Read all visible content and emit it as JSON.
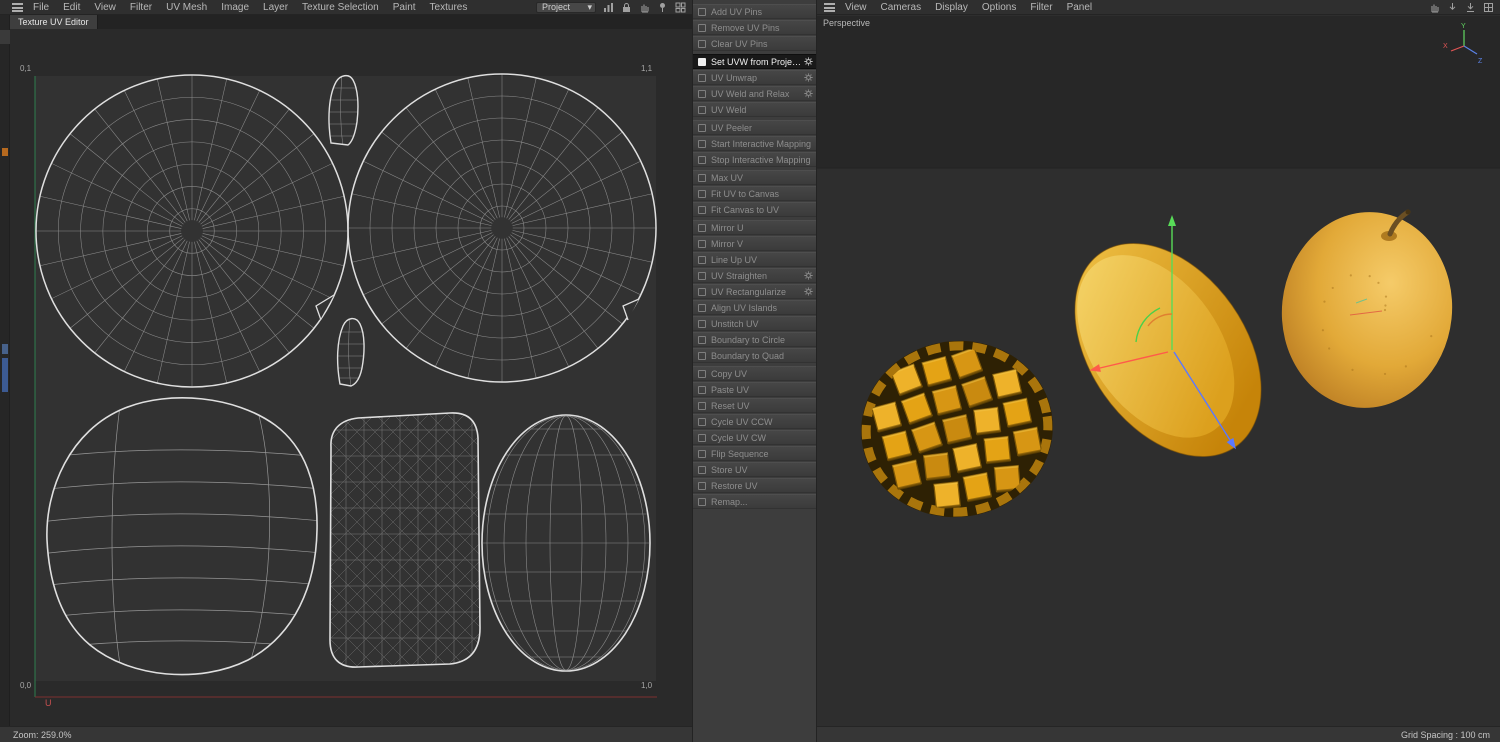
{
  "left_editor": {
    "menu": [
      "File",
      "Edit",
      "View",
      "Filter",
      "UV Mesh",
      "Image",
      "Layer",
      "Texture Selection",
      "Paint",
      "Textures"
    ],
    "project_dropdown": "Project",
    "tab": "Texture UV Editor",
    "corners": {
      "tl": "0,1",
      "tr": "1,1",
      "bl": "0,0",
      "br": "1,0"
    },
    "u_axis_label": "U",
    "status_zoom": "Zoom: 259.0%"
  },
  "icons": {
    "dropdown_caret": "▾"
  },
  "uv_commands": {
    "groups": [
      {
        "items": [
          {
            "label": "Add UV Pins",
            "icon": "add-uv-pins"
          },
          {
            "label": "Remove UV Pins",
            "icon": "remove-uv-pins"
          },
          {
            "label": "Clear UV Pins",
            "icon": "clear-uv-pins"
          }
        ]
      },
      {
        "items": [
          {
            "label": "Set UVW from Projection",
            "icon": "set-uvw-from-projection",
            "enabled": true,
            "gear": true
          },
          {
            "label": "UV Unwrap",
            "icon": "uv-unwrap",
            "gear": true
          },
          {
            "label": "UV Weld and Relax",
            "icon": "uv-weld-and-relax",
            "gear": true
          },
          {
            "label": "UV Weld",
            "icon": "uv-weld"
          }
        ]
      },
      {
        "items": [
          {
            "label": "UV Peeler",
            "icon": "uv-peeler"
          },
          {
            "label": "Start Interactive Mapping",
            "icon": "start-interactive-mapping"
          },
          {
            "label": "Stop Interactive Mapping",
            "icon": "stop-interactive-mapping"
          }
        ]
      },
      {
        "items": [
          {
            "label": "Max UV",
            "icon": "max-uv"
          },
          {
            "label": "Fit UV to Canvas",
            "icon": "fit-uv-to-canvas"
          },
          {
            "label": "Fit Canvas to UV",
            "icon": "fit-canvas-to-uv"
          }
        ]
      },
      {
        "items": [
          {
            "label": "Mirror U",
            "icon": "mirror-u"
          },
          {
            "label": "Mirror V",
            "icon": "mirror-v"
          },
          {
            "label": "Line Up UV",
            "icon": "line-up-uv"
          },
          {
            "label": "UV Straighten",
            "icon": "uv-straighten",
            "gear": true
          },
          {
            "label": "UV Rectangularize",
            "icon": "uv-rectangularize",
            "gear": true
          },
          {
            "label": "Align UV Islands",
            "icon": "align-uv-islands"
          },
          {
            "label": "Unstitch UV",
            "icon": "unstitch-uv"
          },
          {
            "label": "Boundary to Circle",
            "icon": "boundary-to-circle"
          },
          {
            "label": "Boundary to Quad",
            "icon": "boundary-to-quad"
          }
        ]
      },
      {
        "items": [
          {
            "label": "Copy UV",
            "icon": "copy-uv"
          },
          {
            "label": "Paste UV",
            "icon": "paste-uv"
          },
          {
            "label": "Reset UV",
            "icon": "reset-uv"
          },
          {
            "label": "Cycle UV CCW",
            "icon": "cycle-uv-ccw"
          },
          {
            "label": "Cycle UV CW",
            "icon": "cycle-uv-cw"
          },
          {
            "label": "Flip Sequence",
            "icon": "flip-sequence"
          },
          {
            "label": "Store UV",
            "icon": "store-uv"
          },
          {
            "label": "Restore UV",
            "icon": "restore-uv"
          },
          {
            "label": "Remap...",
            "icon": "remap"
          }
        ]
      }
    ]
  },
  "viewport": {
    "menu": [
      "View",
      "Cameras",
      "Display",
      "Options",
      "Filter",
      "Panel"
    ],
    "label": "Perspective",
    "axis": {
      "x": "X",
      "y": "Y",
      "z": "Z"
    },
    "status_grid_spacing": "Grid Spacing : 100 cm"
  },
  "colors": {
    "axis_x": "#e25555",
    "axis_y": "#62d862",
    "axis_z": "#5b83e8",
    "u_axis": "#c85050",
    "wireframe": "#dfdfdf",
    "mango_accent": "#e0a730"
  }
}
